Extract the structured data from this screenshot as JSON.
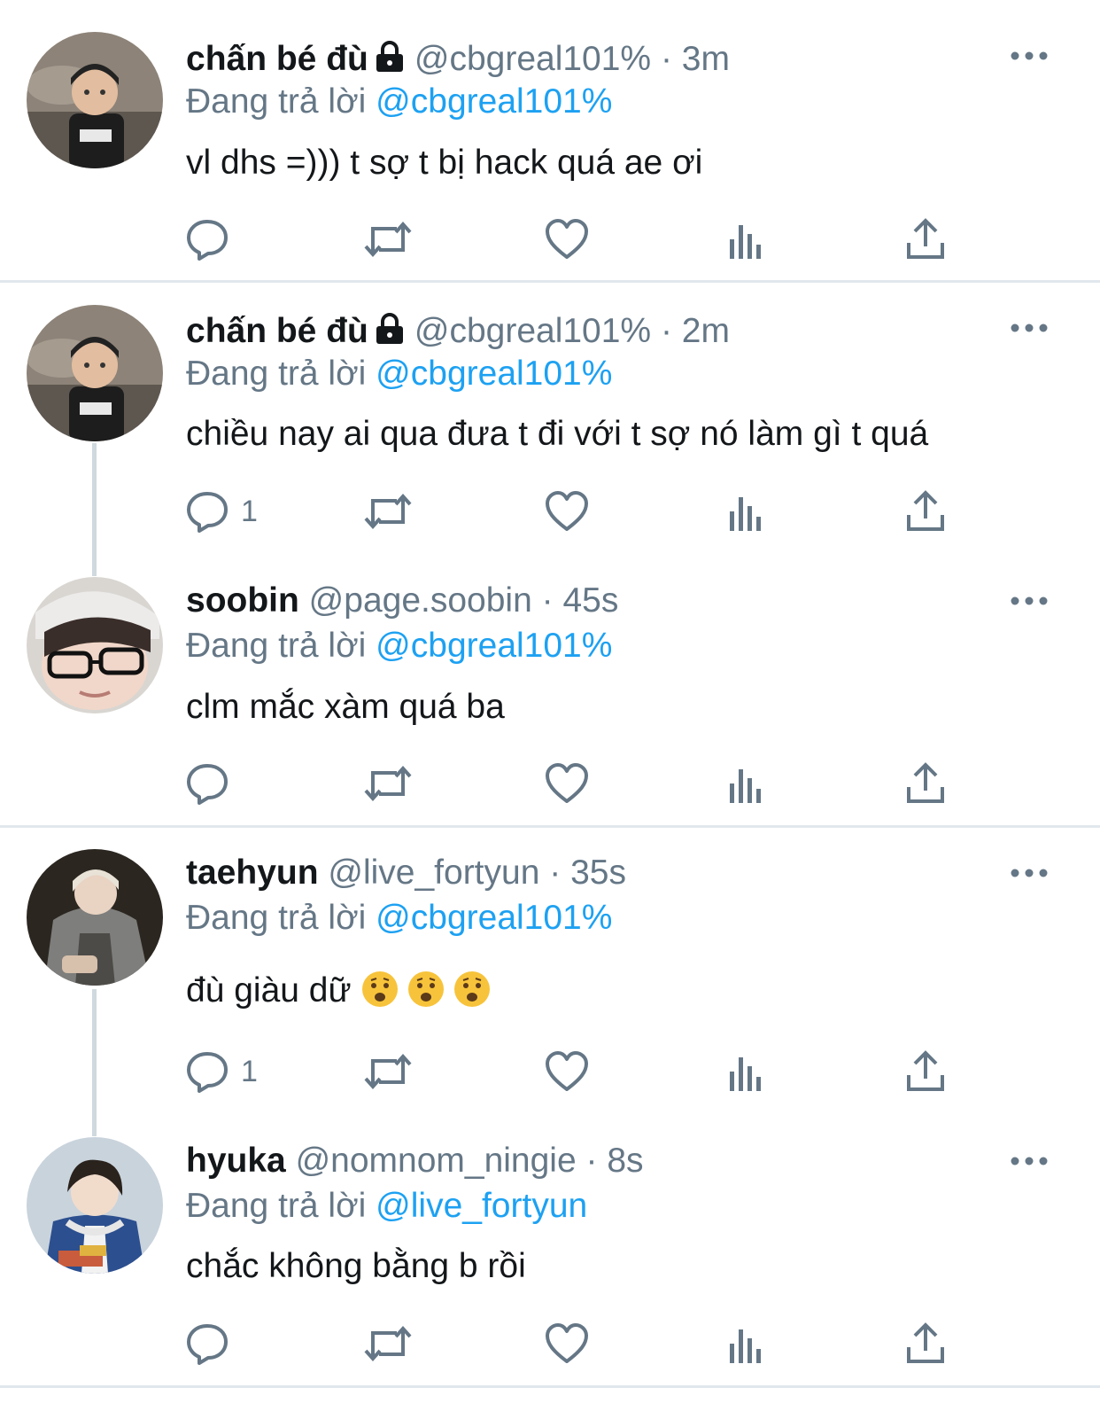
{
  "tweets": [
    {
      "name": "chấn bé đù",
      "handle": "@cbgreal101%",
      "sep": "·",
      "time": "3m",
      "reply_prefix": "Đang trả lời",
      "reply_to": "@cbgreal101%",
      "text": "vl dhs =))) t sợ t bị hack quá ae ơi",
      "reply_count": ""
    },
    {
      "name": "chấn bé đù",
      "handle": "@cbgreal101%",
      "sep": "·",
      "time": "2m",
      "reply_prefix": "Đang trả lời",
      "reply_to": "@cbgreal101%",
      "text": "chiều nay ai qua đưa t đi với t sợ nó làm gì t quá",
      "reply_count": "1"
    },
    {
      "name": "soobin",
      "handle": "@page.soobin",
      "sep": "·",
      "time": "45s",
      "reply_prefix": "Đang trả lời",
      "reply_to": "@cbgreal101%",
      "text": "clm mắc xàm quá ba",
      "reply_count": ""
    },
    {
      "name": "taehyun",
      "handle": "@live_fortyun",
      "sep": "·",
      "time": "35s",
      "reply_prefix": "Đang trả lời",
      "reply_to": "@cbgreal101%",
      "text": "đù giàu dữ",
      "reply_count": "1"
    },
    {
      "name": "hyuka",
      "handle": "@nomnom_ningie",
      "sep": "·",
      "time": "8s",
      "reply_prefix": "Đang trả lời",
      "reply_to": "@live_fortyun",
      "text": "chắc không bằng b rồi",
      "reply_count": ""
    }
  ],
  "icons": {
    "reply": "reply-icon",
    "retweet": "retweet-icon",
    "like": "like-icon",
    "views": "views-icon",
    "share": "share-icon",
    "more": "more-icon",
    "lock": "lock-icon",
    "emoji": "anguished-face-emoji"
  },
  "colors": {
    "link": "#1da1f2",
    "secondary": "#657786",
    "text": "#14171a",
    "divider": "#e1e8ed"
  }
}
